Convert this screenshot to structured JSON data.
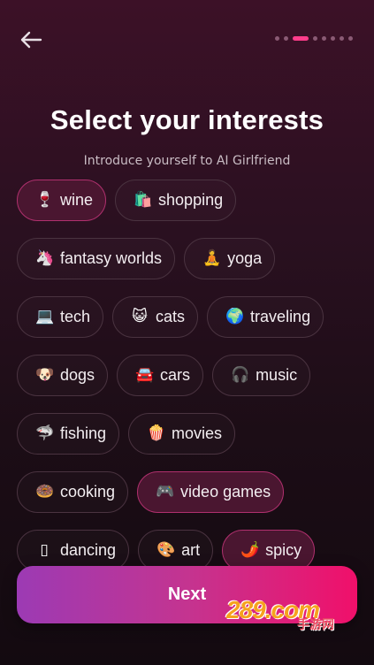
{
  "header": {
    "back_icon": "arrow-left-icon",
    "progress_steps": 8,
    "progress_current": 3
  },
  "title": "Select your interests",
  "subtitle": "Introduce yourself to AI Girlfriend",
  "rows": [
    [
      {
        "emoji": "🍷",
        "label": "wine",
        "selected": true
      },
      {
        "emoji": "🛍️",
        "label": "shopping",
        "selected": false
      }
    ],
    [
      {
        "emoji": "🦄",
        "label": "fantasy worlds",
        "selected": false
      },
      {
        "emoji": "🧘",
        "label": "yoga",
        "selected": false
      }
    ],
    [
      {
        "emoji": "💻",
        "label": "tech",
        "selected": false
      },
      {
        "emoji": "😺",
        "label": "cats",
        "selected": false
      },
      {
        "emoji": "🌍",
        "label": "traveling",
        "selected": false
      }
    ],
    [
      {
        "emoji": "🐶",
        "label": "dogs",
        "selected": false
      },
      {
        "emoji": "🚘",
        "label": "cars",
        "selected": false
      },
      {
        "emoji": "🎧",
        "label": "music",
        "selected": false
      }
    ],
    [
      {
        "emoji": "🦈",
        "label": "fishing",
        "selected": false
      },
      {
        "emoji": "🍿",
        "label": "movies",
        "selected": false
      }
    ],
    [
      {
        "emoji": "🍩",
        "label": "cooking",
        "selected": false
      },
      {
        "emoji": "🎮",
        "label": "video games",
        "selected": true
      }
    ],
    [
      {
        "emoji": "▯",
        "label": "dancing",
        "selected": false
      },
      {
        "emoji": "🎨",
        "label": "art",
        "selected": false
      },
      {
        "emoji": "🌶️",
        "label": "spicy",
        "selected": true
      }
    ]
  ],
  "next_button": {
    "label": "Next"
  },
  "watermark": {
    "main": "289.com",
    "sub": "手游网"
  },
  "colors": {
    "accent": "#ff3d8b",
    "selected_bg": "#4a1630",
    "selected_border": "#b0306e",
    "chip_border": "#4a3340",
    "button_gradient_start": "#9c3ab4",
    "button_gradient_end": "#f0106a"
  }
}
